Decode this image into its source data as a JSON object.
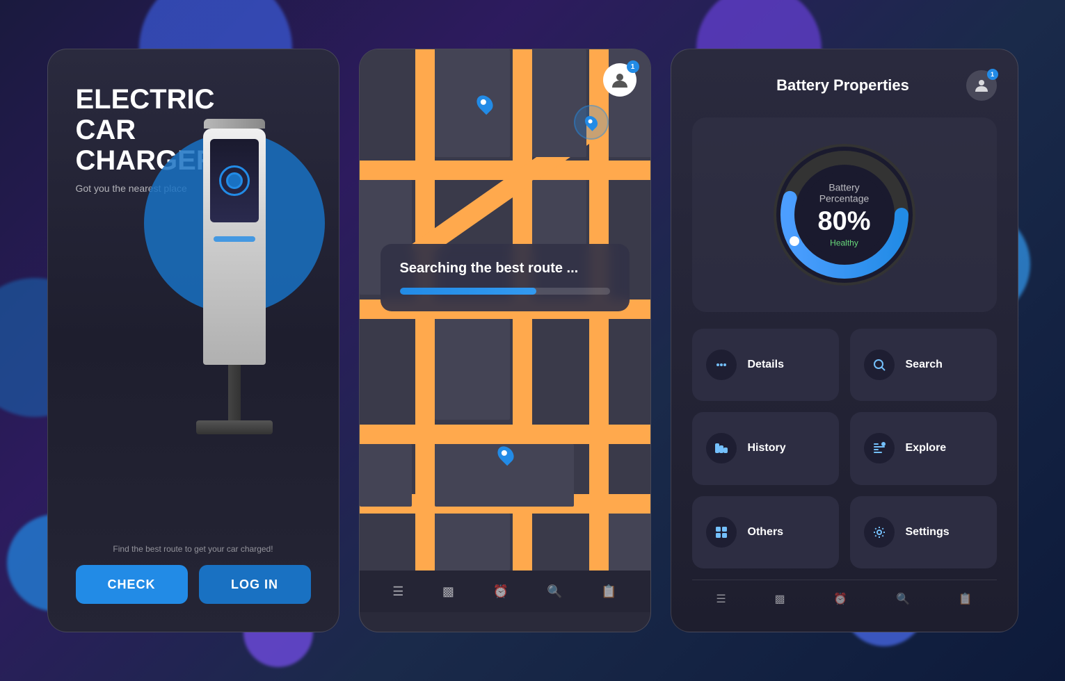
{
  "background": {
    "color": "#1a1a3e"
  },
  "screen1": {
    "title": "ELECTRIC\nCAR\nCHARGER",
    "subtitle": "Got you the nearest place",
    "footer_hint": "Find the best route to get your car charged!",
    "btn_check": "CHECK",
    "btn_login": "LOG IN"
  },
  "screen2": {
    "searching_text": "Searching the best route ...",
    "avatar_badge": "1",
    "progress_percent": 65
  },
  "screen3": {
    "title": "Battery Properties",
    "avatar_badge": "1",
    "battery_label": "Battery\nPercentage",
    "battery_percent": "80%",
    "battery_status": "Healthy",
    "menu_items": [
      {
        "icon": "⋯",
        "label": "Details"
      },
      {
        "icon": "🔍",
        "label": "Search"
      },
      {
        "icon": "📊",
        "label": "History"
      },
      {
        "icon": "☰",
        "label": "Explore"
      },
      {
        "icon": "⊞",
        "label": "Others"
      },
      {
        "icon": "⚙",
        "label": "Settings"
      }
    ],
    "nav_icons": [
      "☰",
      "📊",
      "⏰",
      "🔍",
      "📋"
    ]
  }
}
